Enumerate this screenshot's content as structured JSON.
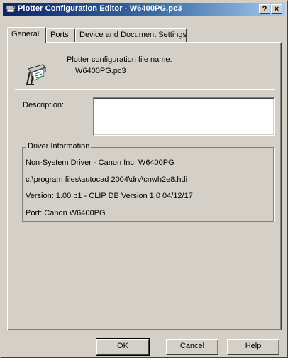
{
  "window": {
    "title": "Plotter Configuration Editor - W6400PG.pc3",
    "help_button": "?",
    "close_button": "×",
    "title_icon": "plotter-app-icon"
  },
  "tabs": [
    {
      "label": "General",
      "active": true
    },
    {
      "label": "Ports",
      "active": false
    },
    {
      "label": "Device and Document Settings",
      "active": false
    }
  ],
  "general": {
    "config_file_label": "Plotter configuration file name:",
    "config_file_name": "W6400PG.pc3",
    "plotter_icon": "plotter-icon",
    "description_label": "Description:",
    "description_value": "",
    "driver_info": {
      "title": "Driver Information",
      "lines": [
        "Non-System Driver - Canon Inc. W6400PG",
        "c:\\program files\\autocad 2004\\drv\\cnwh2e8.hdi",
        "Version: 1.00 b1 - CLIP DB Version 1.0  04/12/17",
        "Port: Canon W6400PG"
      ]
    }
  },
  "buttons": {
    "ok": "OK",
    "cancel": "Cancel",
    "help": "Help"
  }
}
